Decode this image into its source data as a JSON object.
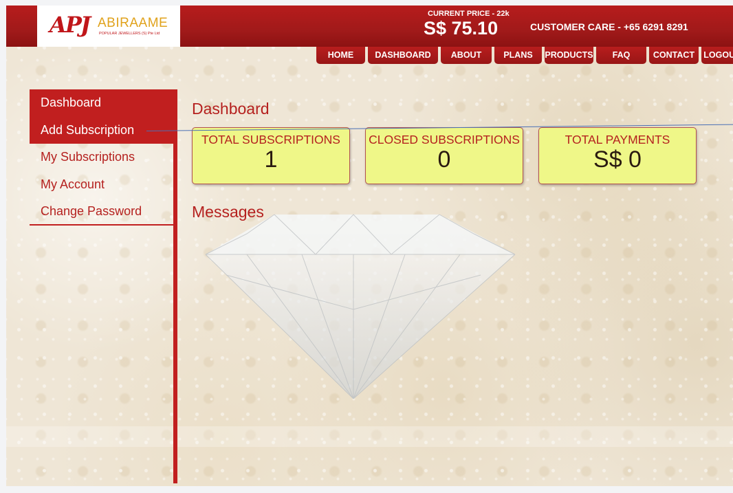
{
  "header": {
    "logo": {
      "mark": "APJ",
      "name": "ABIRAAME",
      "tagline": "POPULAR JEWELLERS (S) Pte Ltd"
    },
    "price_label": "CURRENT PRICE - 22k",
    "price_value": "S$ 75.10",
    "customer_care": "CUSTOMER CARE - +65 6291 8291"
  },
  "nav": {
    "items": [
      {
        "label": "HOME"
      },
      {
        "label": "DASHBOARD"
      },
      {
        "label": "ABOUT"
      },
      {
        "label": "PLANS"
      },
      {
        "label": "PRODUCTS"
      },
      {
        "label": "FAQ"
      },
      {
        "label": "CONTACT"
      },
      {
        "label": "LOGOUT"
      }
    ]
  },
  "sidebar": {
    "items": [
      {
        "label": "Dashboard",
        "active": true
      },
      {
        "label": "Add Subscription",
        "active": true
      },
      {
        "label": "My Subscriptions",
        "active": false
      },
      {
        "label": "My Account",
        "active": false
      },
      {
        "label": "Change Password",
        "active": false
      }
    ]
  },
  "main": {
    "title": "Dashboard",
    "cards": [
      {
        "title": "TOTAL SUBSCRIPTIONS",
        "value": "1"
      },
      {
        "title": "CLOSED SUBSCRIPTIONS",
        "value": "0"
      },
      {
        "title": "TOTAL PAYMENTS",
        "value": "S$ 0"
      }
    ],
    "messages_title": "Messages"
  },
  "colors": {
    "brand_red": "#c11f1f",
    "card_bg": "#eff788",
    "gold": "#e0a21b"
  }
}
